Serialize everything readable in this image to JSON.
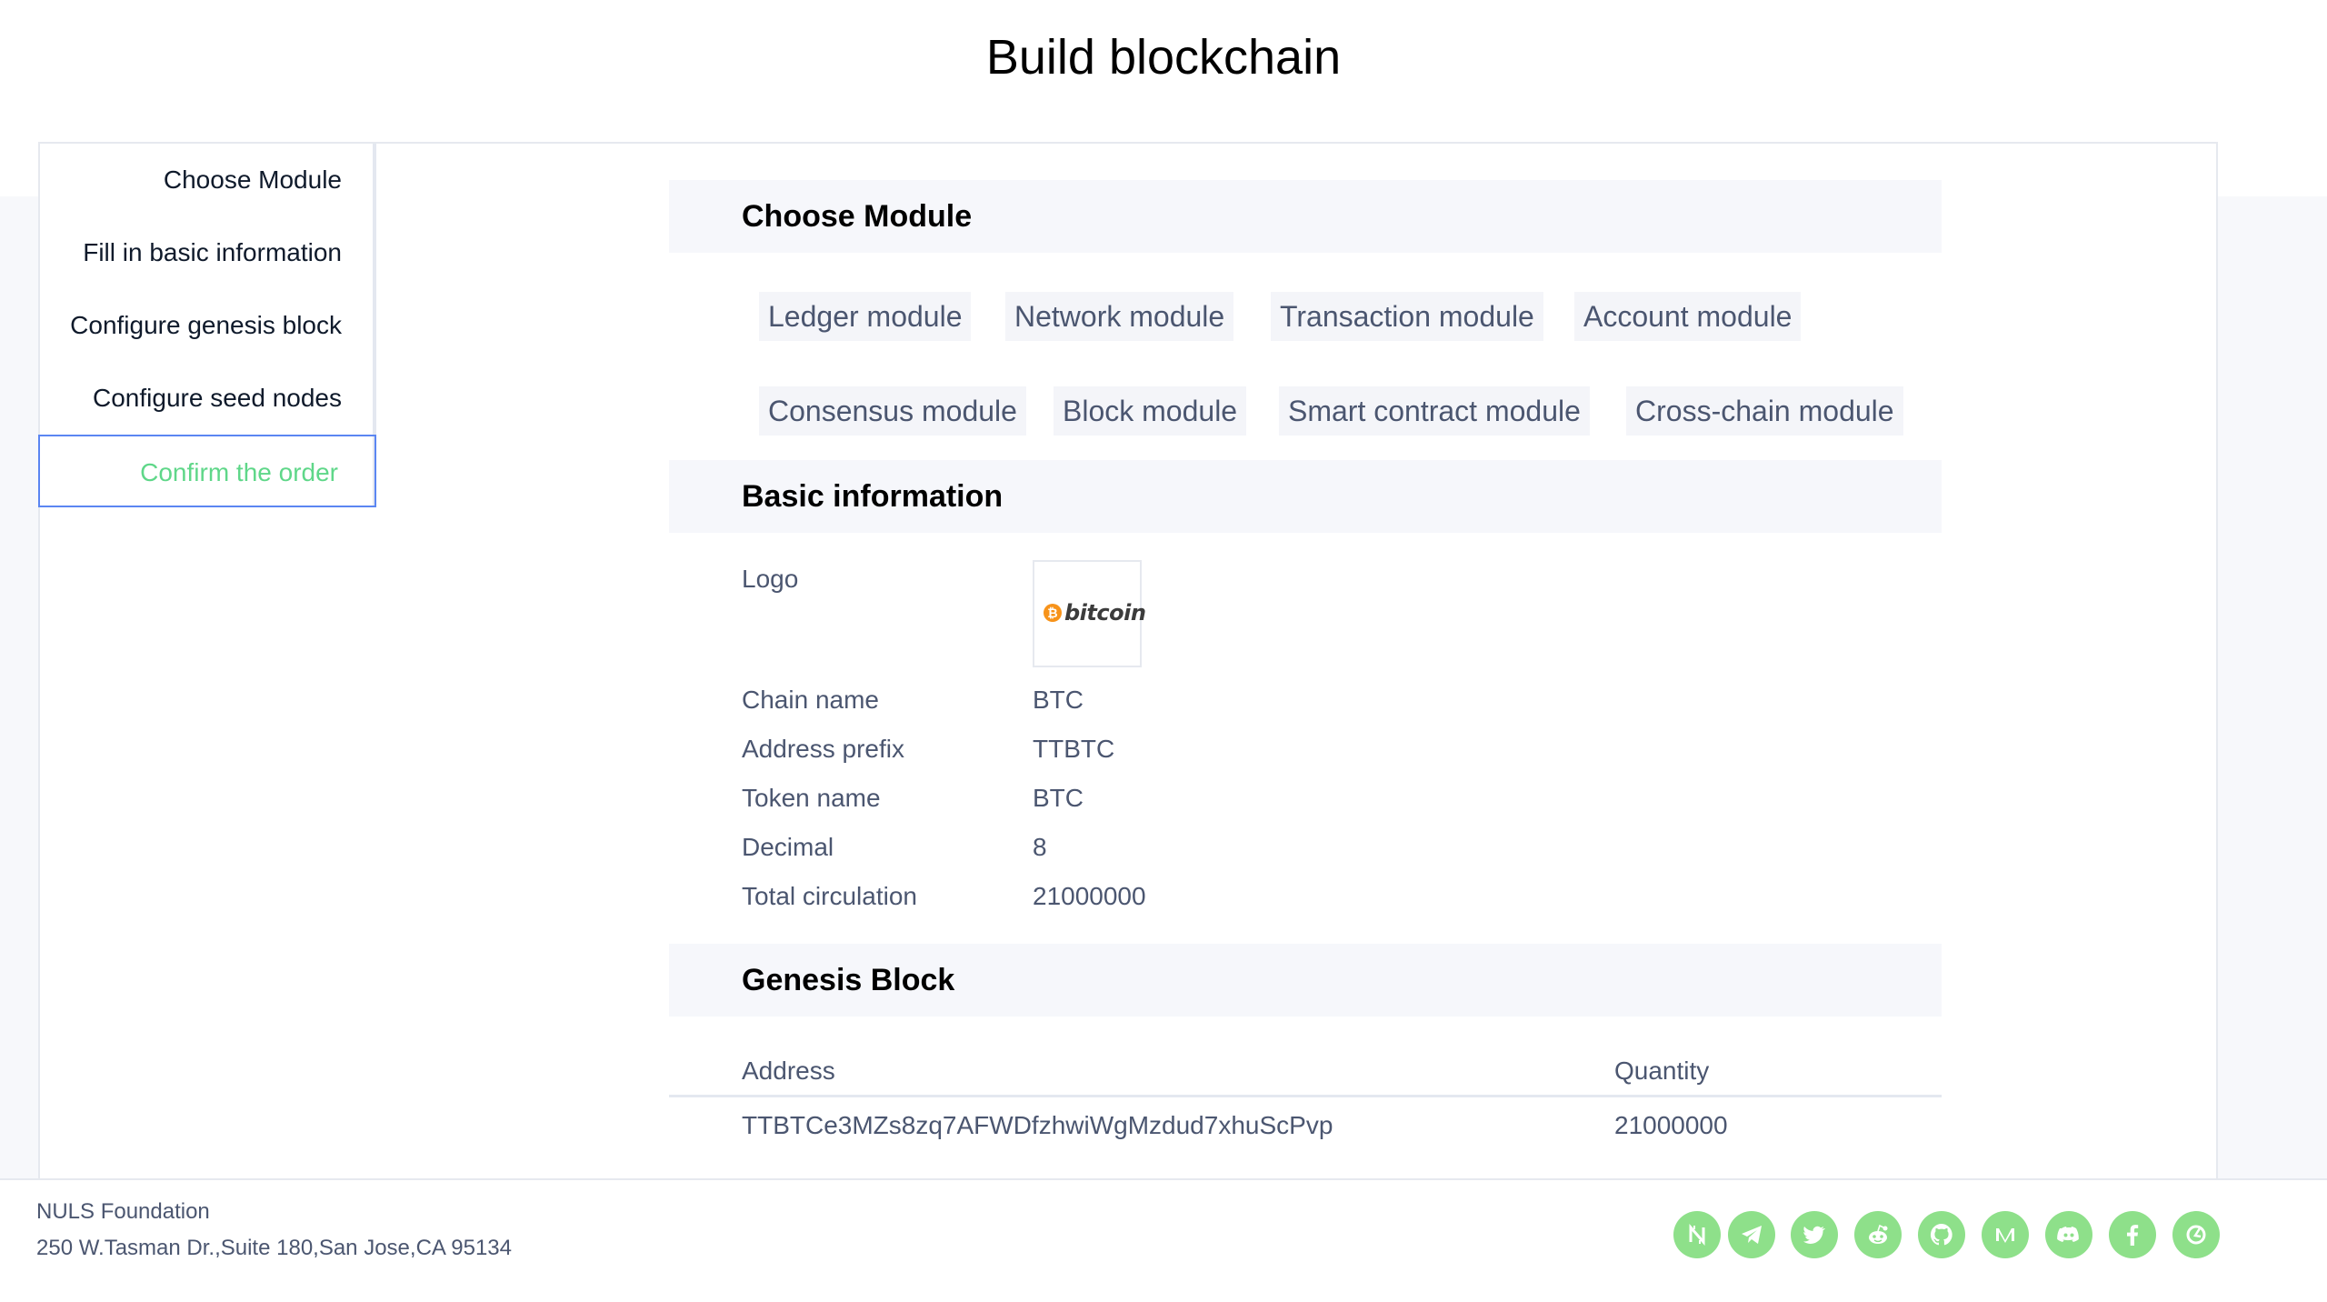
{
  "page": {
    "title": "Build blockchain"
  },
  "sidebar": {
    "items": [
      {
        "label": "Choose Module"
      },
      {
        "label": "Fill in basic information"
      },
      {
        "label": "Configure genesis block"
      },
      {
        "label": "Configure seed nodes"
      },
      {
        "label": "Confirm the order",
        "active": true
      }
    ]
  },
  "modules": {
    "title": "Choose Module",
    "items": [
      "Ledger module",
      "Network module",
      "Transaction module",
      "Account module",
      "Consensus module",
      "Block module",
      "Smart contract module",
      "Cross-chain module"
    ]
  },
  "basic": {
    "title": "Basic information",
    "logo_label": "Logo",
    "logo_text": "bitcoin",
    "logo_coin_symbol": "₿",
    "fields": [
      {
        "label": "Chain name",
        "value": "BTC"
      },
      {
        "label": "Address prefix",
        "value": "TTBTC"
      },
      {
        "label": "Token name",
        "value": "BTC"
      },
      {
        "label": "Decimal",
        "value": "8"
      },
      {
        "label": "Total circulation",
        "value": "21000000"
      }
    ]
  },
  "genesis": {
    "title": "Genesis Block",
    "columns": [
      "Address",
      "Quantity"
    ],
    "rows": [
      {
        "address": "TTBTCe3MZs8zq7AFWDfzhwiWgMzdud7xhuScPvp",
        "quantity": "21000000"
      }
    ]
  },
  "footer": {
    "org": "NULS Foundation",
    "address": "250 W.Tasman Dr.,Suite 180,San Jose,CA 95134",
    "social_icons": [
      "nuls-icon",
      "telegram-icon",
      "twitter-icon",
      "reddit-icon",
      "github-icon",
      "medium-icon",
      "discord-icon",
      "facebook-icon",
      "wechat-icon"
    ],
    "icon_color": "#8ee08a"
  },
  "colors": {
    "active_text": "#5fd789",
    "active_border": "#5b86f2",
    "section_bg": "#f6f7fb"
  }
}
